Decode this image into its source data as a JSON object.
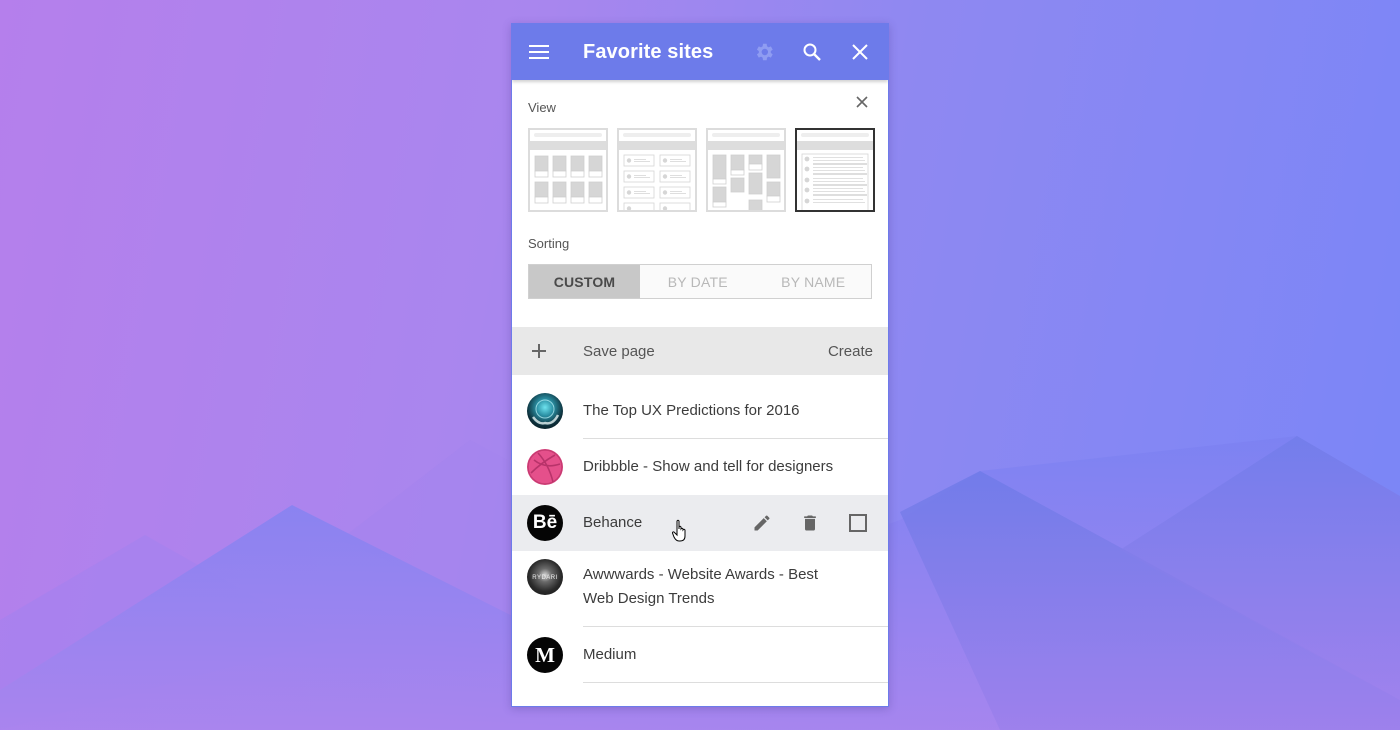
{
  "header": {
    "title": "Favorite sites",
    "menu_icon": "hamburger-menu-icon",
    "settings_icon": "gear-icon",
    "search_icon": "search-icon",
    "close_icon": "close-icon"
  },
  "view": {
    "label": "View",
    "close_icon": "close-icon",
    "options": [
      {
        "name": "grid",
        "selected": false
      },
      {
        "name": "cards",
        "selected": false
      },
      {
        "name": "masonry",
        "selected": false
      },
      {
        "name": "list",
        "selected": true
      }
    ]
  },
  "sorting": {
    "label": "Sorting",
    "options": [
      {
        "label": "CUSTOM",
        "active": true
      },
      {
        "label": "BY DATE",
        "active": false
      },
      {
        "label": "BY NAME",
        "active": false
      }
    ]
  },
  "save_row": {
    "plus_icon": "plus-icon",
    "label": "Save page",
    "action": "Create"
  },
  "sites": [
    {
      "title": "The Top UX Predictions for 2016",
      "avatar": "crystal-ball"
    },
    {
      "title": "Dribbble - Show and tell for designers",
      "avatar": "dribbble"
    },
    {
      "title": "Behance",
      "avatar": "behance",
      "avatar_text": "Bē",
      "hovered": true,
      "actions": [
        "edit-icon",
        "delete-icon",
        "checkbox"
      ]
    },
    {
      "title": "Awwwards - Website Awards - Best Web Design Trends",
      "avatar": "awwwards"
    },
    {
      "title": "Medium",
      "avatar": "medium",
      "avatar_text": "M"
    }
  ],
  "colors": {
    "appbar": "#6d7bea",
    "save_row_bg": "#e8e8e8",
    "hover_row_bg": "#ebecef",
    "sort_active_bg": "#c8c8c8",
    "dribbble_pink": "#ea4c89"
  }
}
